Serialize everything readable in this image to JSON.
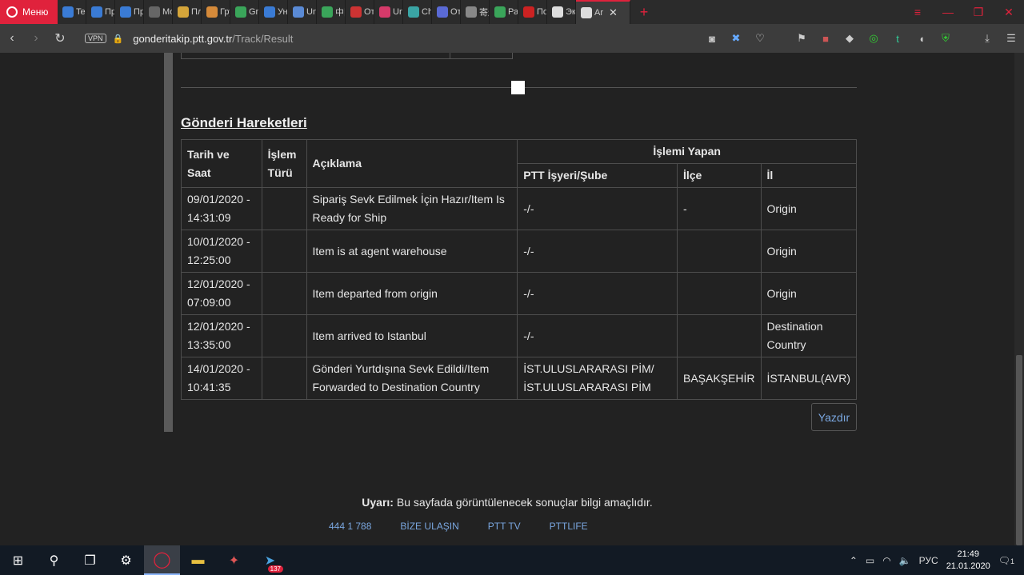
{
  "browser": {
    "menu_label": "Меню",
    "tabs": [
      {
        "label": "Tele",
        "color": "#3a7bd5"
      },
      {
        "label": "Про",
        "color": "#3a7bd5"
      },
      {
        "label": "Пре",
        "color": "#3a7bd5"
      },
      {
        "label": "Мо",
        "color": "#666666"
      },
      {
        "label": "Пла",
        "color": "#d5a53a"
      },
      {
        "label": "Гру",
        "color": "#d58a3a"
      },
      {
        "label": "Grai",
        "color": "#3aa55a"
      },
      {
        "label": "Уни",
        "color": "#3a7bd5"
      },
      {
        "label": "Univ",
        "color": "#5a8ad5"
      },
      {
        "label": "中国",
        "color": "#3aa55a"
      },
      {
        "label": "Отс",
        "color": "#cc3333"
      },
      {
        "label": "Univ",
        "color": "#d53a6a"
      },
      {
        "label": "Chir",
        "color": "#3aa5a5"
      },
      {
        "label": "Отс",
        "color": "#5a6ad5"
      },
      {
        "label": "寄送",
        "color": "#888888"
      },
      {
        "label": "Раз",
        "color": "#3aa55a"
      },
      {
        "label": "Пол",
        "color": "#cc2222"
      },
      {
        "label": "Экс",
        "color": "#dddddd"
      }
    ],
    "active_tab": {
      "label": "Ar",
      "color": "#dddddd"
    },
    "url_host": "gonderitakip.ptt.gov.tr",
    "url_path": "/Track/Result",
    "vpn_label": "VPN"
  },
  "page": {
    "section_title": "Gönderi Hareketleri",
    "table": {
      "headers": {
        "date": "Tarih ve Saat",
        "type": "İşlem Türü",
        "desc": "Açıklama",
        "by": "İşlemi Yapan",
        "branch": "PTT İşyeri/Şube",
        "district": "İlçe",
        "city": "İl"
      },
      "rows": [
        {
          "date": "09/01/2020 - 14:31:09",
          "type": "",
          "desc": "Sipariş Sevk Edilmek İçin Hazır/Item Is Ready for Ship",
          "branch": "-/-",
          "district": "-",
          "city": "Origin"
        },
        {
          "date": "10/01/2020 - 12:25:00",
          "type": "",
          "desc": "Item is at agent warehouse",
          "branch": "-/-",
          "district": "",
          "city": "Origin"
        },
        {
          "date": "12/01/2020 - 07:09:00",
          "type": "",
          "desc": "Item departed from origin",
          "branch": "-/-",
          "district": "",
          "city": "Origin"
        },
        {
          "date": "12/01/2020 - 13:35:00",
          "type": "",
          "desc": "Item arrived to Istanbul",
          "branch": "-/-",
          "district": "",
          "city": "Destination Country"
        },
        {
          "date": "14/01/2020 - 10:41:35",
          "type": "",
          "desc": "Gönderi Yurtdışına Sevk Edildi/Item Forwarded to Destination Country",
          "branch": "İST.ULUSLARARASI PİM/ İST.ULUSLARARASI PİM",
          "district": "BAŞAKŞEHİR",
          "city": "İSTANBUL(AVR)"
        }
      ]
    },
    "print_label": "Yazdır",
    "notice_bold": "Uyarı:",
    "notice_text": " Bu sayfada görüntülenecek sonuçlar bilgi amaçlıdır.",
    "footer_links": [
      "444 1 788",
      "BİZE ULAŞIN",
      "PTT TV",
      "PTTLIFE"
    ]
  },
  "taskbar": {
    "telegram_badge": "137",
    "language": "РУС",
    "time": "21:49",
    "date": "21.01.2020",
    "notification_count": "1"
  }
}
